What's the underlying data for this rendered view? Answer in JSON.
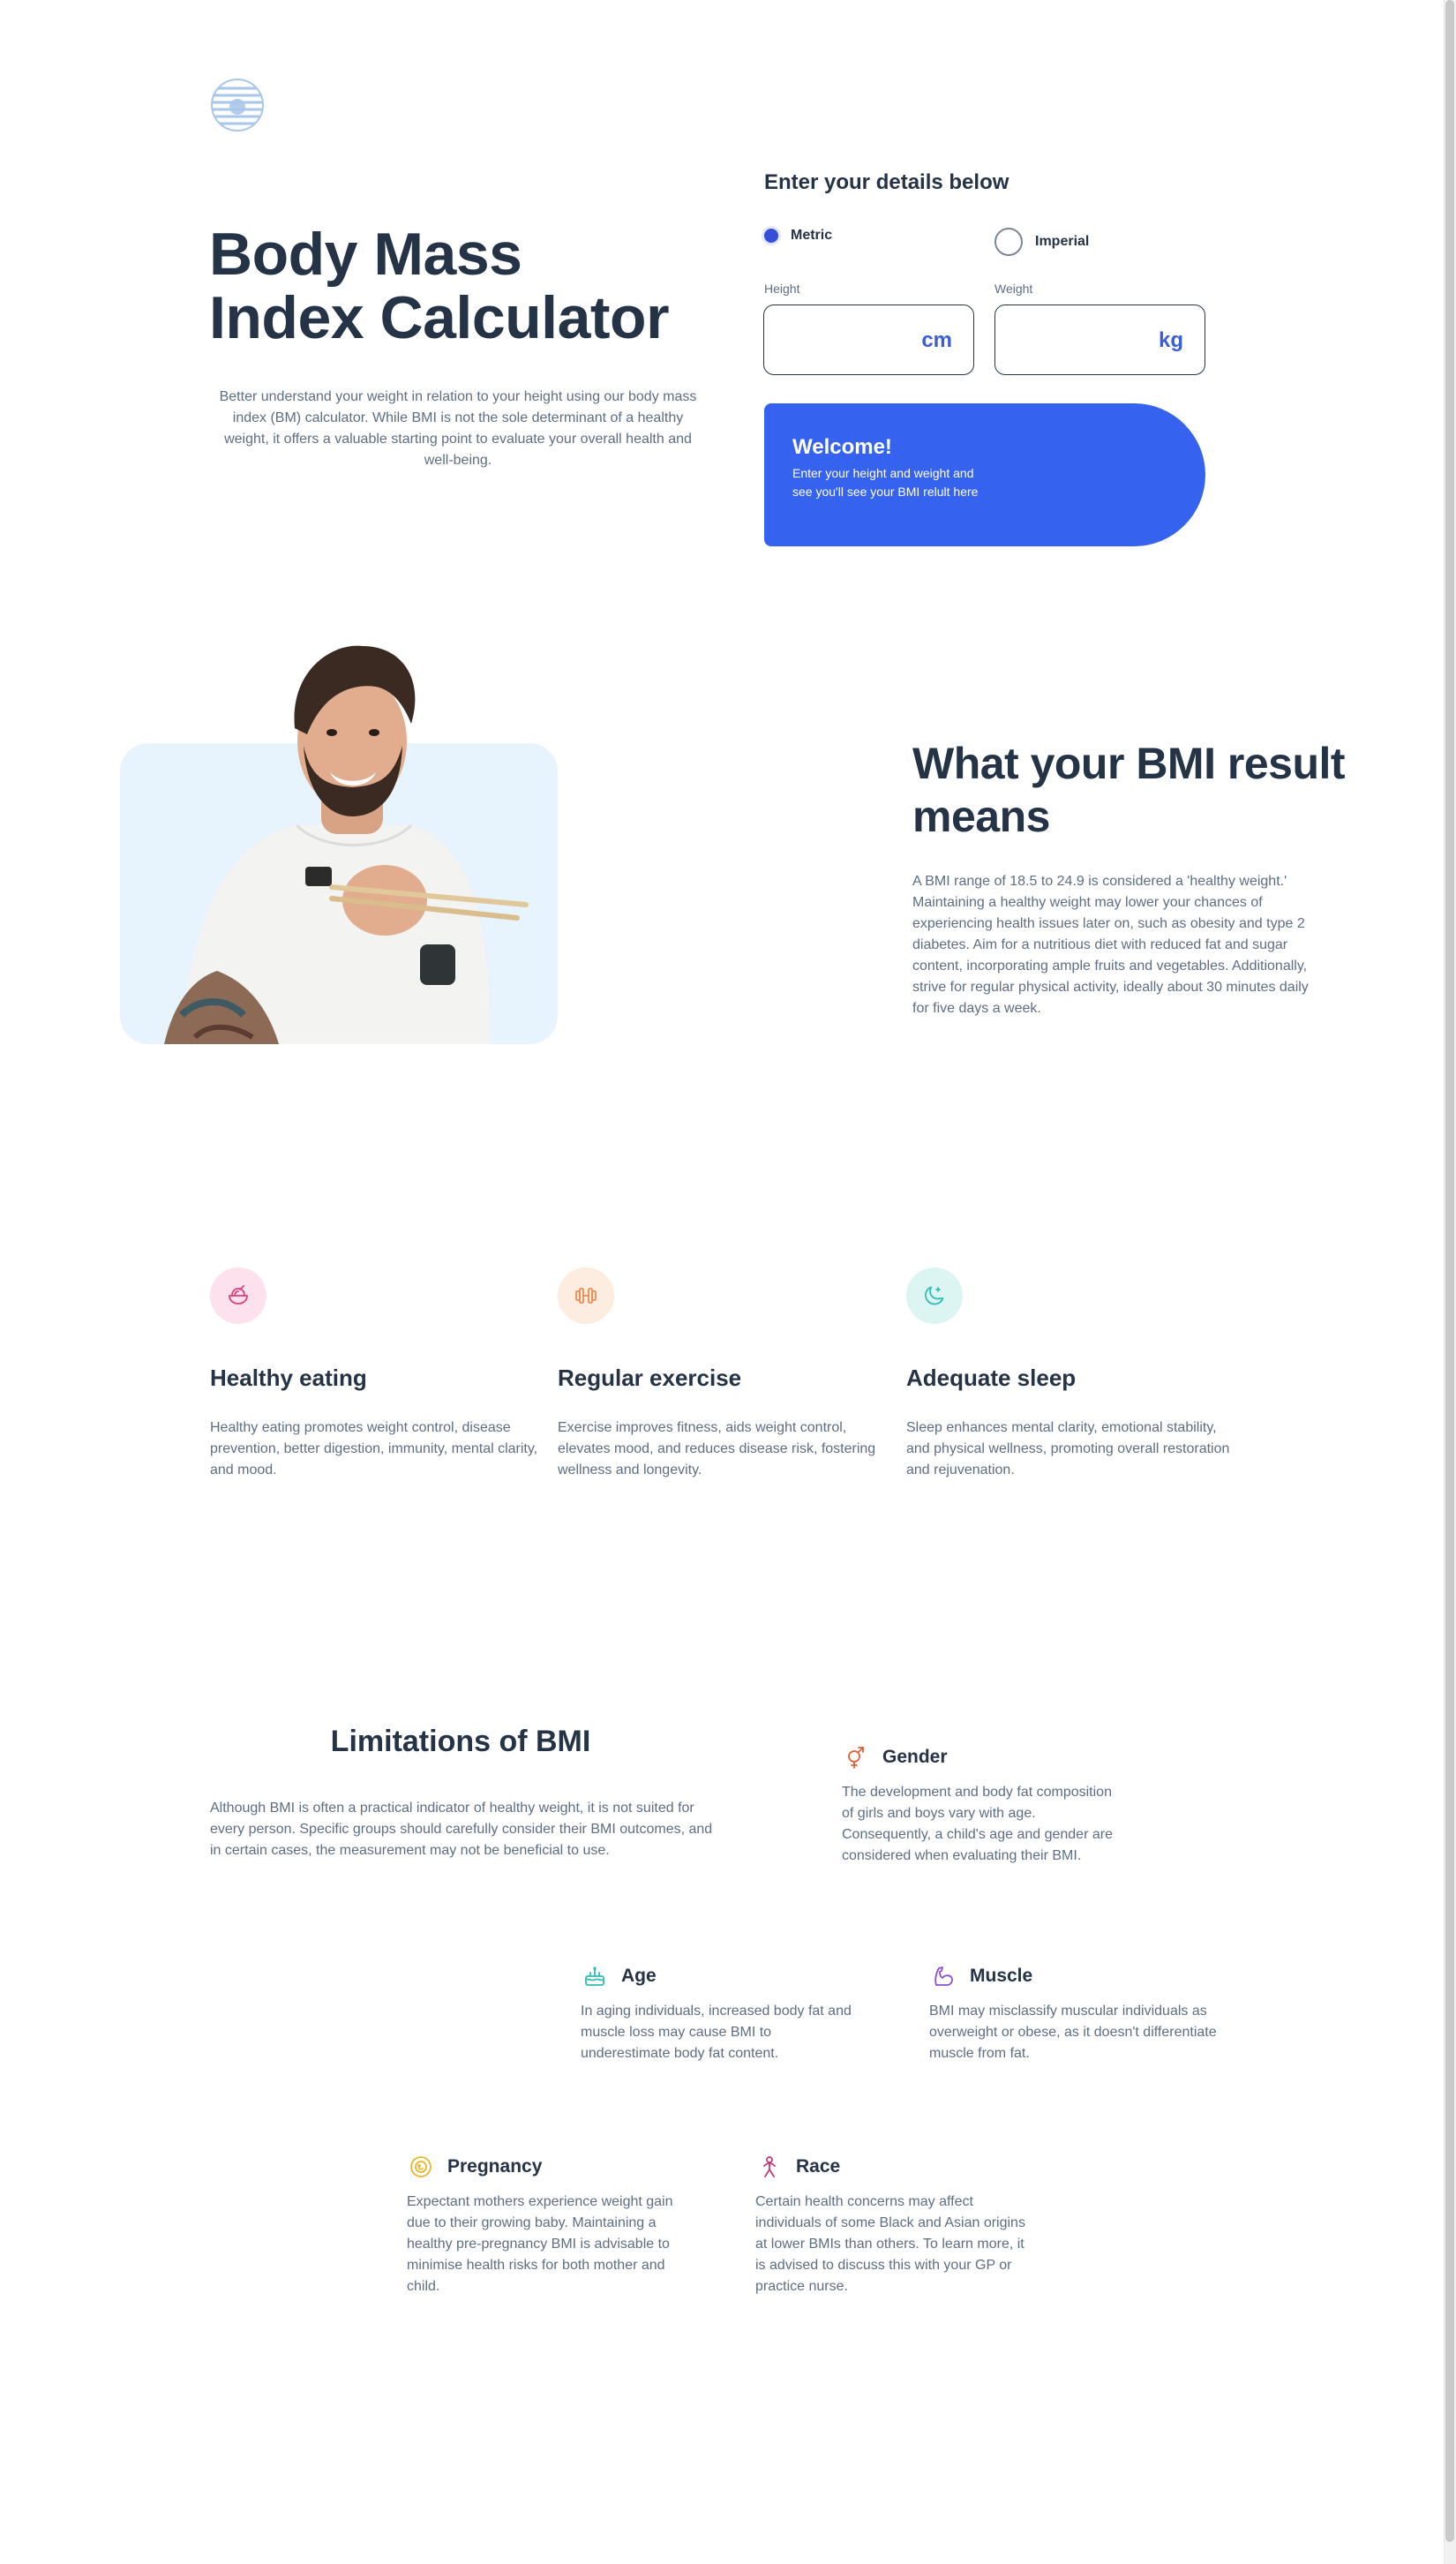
{
  "hero": {
    "title_line1": "Body Mass",
    "title_line2": "Index Calculator",
    "description": "Better understand your weight in relation to your height using our body mass index (BM) calculator. While BMI is not the sole determinant of a healthy weight, it offers a valuable starting point to evaluate your overall health and well-being."
  },
  "form": {
    "heading": "Enter your details below",
    "metric_label": "Metric",
    "imperial_label": "Imperial",
    "selected_system": "Metric",
    "height_label": "Height",
    "weight_label": "Weight",
    "height_value": "",
    "weight_value": "",
    "height_unit": "cm",
    "weight_unit": "kg"
  },
  "result": {
    "title": "Welcome!",
    "text": "Enter your height and weight and see you'll see your BMI relult here"
  },
  "meaning": {
    "title": "What your BMI result means",
    "description": "A BMI range of 18.5 to 24.9 is considered a 'healthy weight.' Maintaining a healthy weight may lower your chances of experiencing health issues later on, such as obesity and type 2 diabetes. Aim for a nutritious diet with reduced fat and sugar content, incorporating ample fruits and vegetables. Additionally, strive for regular physical activity, ideally about 30 minutes daily for five days a week."
  },
  "features": [
    {
      "icon": "food-bowl-icon",
      "color": "#d8407e",
      "bg": "#fde1ec",
      "title": "Healthy eating",
      "text": "Healthy eating promotes weight control, disease prevention, better digestion, immunity, mental clarity, and mood."
    },
    {
      "icon": "dumbbell-icon",
      "color": "#ec8c52",
      "bg": "#fdece0",
      "title": "Regular exercise",
      "text": "Exercise improves fitness, aids weight control, elevates mood, and reduces disease risk, fostering wellness and longevity."
    },
    {
      "icon": "moon-icon",
      "color": "#2fbfb4",
      "bg": "#dcf5f3",
      "title": "Adequate sleep",
      "text": "Sleep enhances mental clarity, emotional stability, and physical wellness, promoting overall restoration and rejuvenation."
    }
  ],
  "limitations": {
    "title": "Limitations of BMI",
    "text": "Although BMI is often a practical indicator of healthy weight, it is not suited for every person. Specific groups should carefully consider their BMI outcomes, and in certain cases, the measurement may not be beneficial to use.",
    "factors": {
      "gender": {
        "icon": "gender-icon",
        "color": "#e0603c",
        "title": "Gender",
        "text": "The development and body fat composition of girls and boys vary with age. Consequently, a child's age and gender are considered when evaluating their BMI."
      },
      "age": {
        "icon": "birthday-cake-icon",
        "color": "#2fbfb4",
        "title": "Age",
        "text": "In aging individuals, increased body fat and muscle loss may cause BMI to underestimate body fat content."
      },
      "muscle": {
        "icon": "flexed-bicep-icon",
        "color": "#8a4fd6",
        "title": "Muscle",
        "text": "BMI may misclassify muscular individuals as overweight or obese, as it doesn't differentiate muscle from fat."
      },
      "pregnancy": {
        "icon": "pregnancy-icon",
        "color": "#e8b62a",
        "title": "Pregnancy",
        "text": "Expectant mothers experience weight gain due to their growing baby. Maintaining a healthy pre-pregnancy BMI is advisable to minimise health risks for both mother and child."
      },
      "race": {
        "icon": "person-race-icon",
        "color": "#c23a78",
        "title": "Race",
        "text": "Certain health concerns may affect individuals of some Black and Asian origins at lower BMIs than others. To learn more, it is advised to discuss this with your GP or practice nurse."
      }
    }
  },
  "colors": {
    "accent": "#3662f0",
    "heading": "#253347",
    "body_text": "#5e6e82",
    "photo_bg": "#e7f3fd"
  }
}
